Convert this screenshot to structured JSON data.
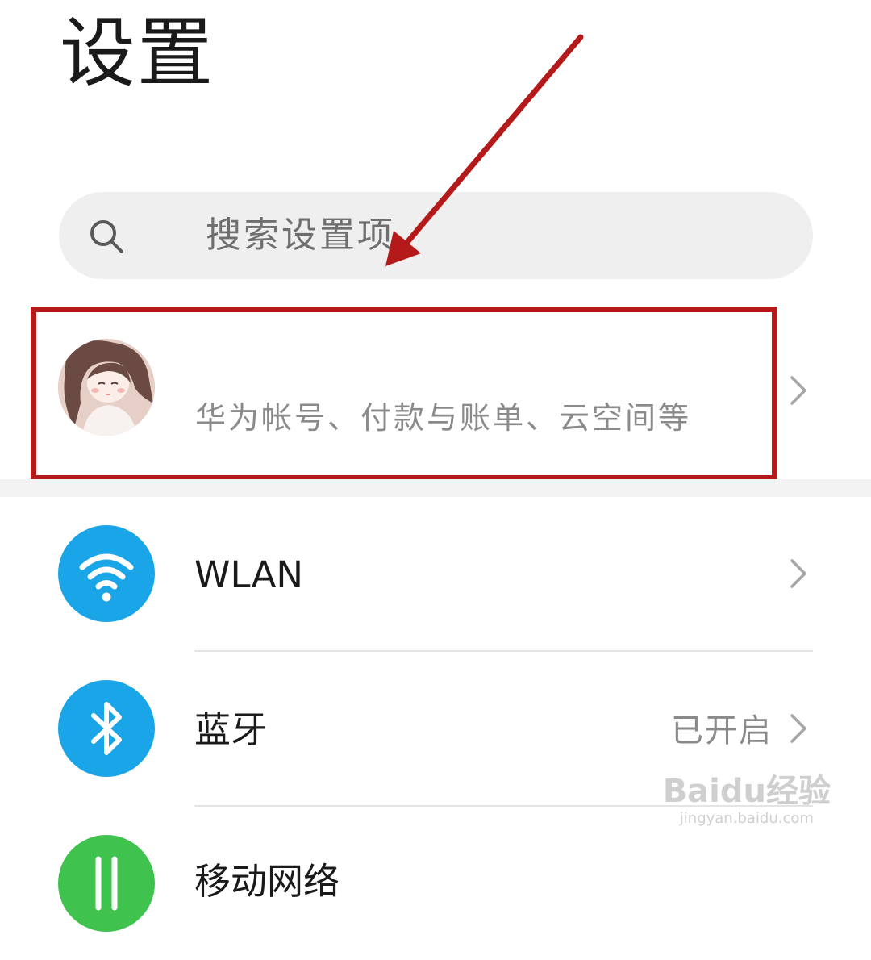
{
  "header": {
    "title": "设置"
  },
  "search": {
    "placeholder": "搜索设置项",
    "icon": "search-icon"
  },
  "account": {
    "subtitle": "华为帐号、付款与账单、云空间等",
    "avatar_icon": "anime-girl-avatar"
  },
  "menu": {
    "items": [
      {
        "label": "WLAN",
        "status": "",
        "icon": "wifi-icon",
        "icon_color": "#1aa5e8"
      },
      {
        "label": "蓝牙",
        "status": "已开启",
        "icon": "bluetooth-icon",
        "icon_color": "#1aa5e8"
      },
      {
        "label": "移动网络",
        "status": "",
        "icon": "mobile-network-icon",
        "icon_color": "#3fc24e"
      }
    ]
  },
  "annotation": {
    "box_color": "#b51a1a",
    "arrow_color": "#b51a1a"
  },
  "watermark": {
    "brand": "Baidu经验",
    "url": "jingyan.baidu.com"
  }
}
